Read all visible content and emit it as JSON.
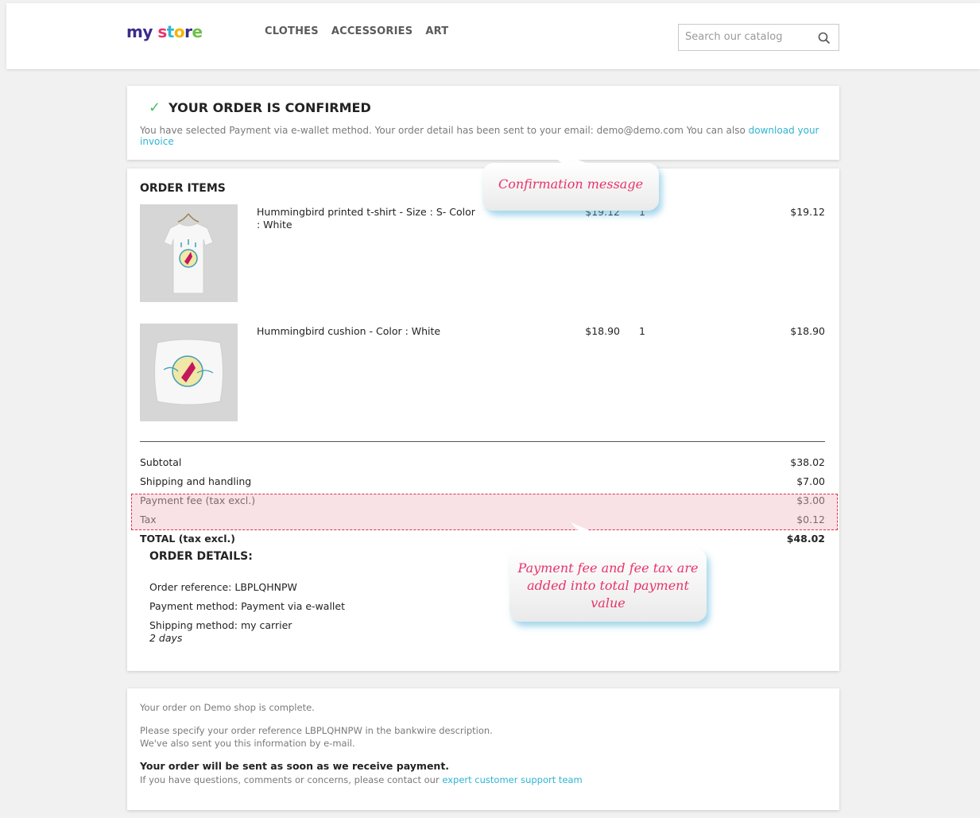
{
  "header": {
    "logo": {
      "part1": "my",
      "part2": "s",
      "part3": "t",
      "part4": "o",
      "part5": "r",
      "part6": "e"
    },
    "nav": [
      "CLOTHES",
      "ACCESSORIES",
      "ART"
    ],
    "search_placeholder": "Search our catalog"
  },
  "confirmation": {
    "title": "YOUR ORDER IS CONFIRMED",
    "text": "You have selected Payment via e-wallet method. Your order detail has been sent to your email: demo@demo.com You can also ",
    "invoice_link": "download your invoice"
  },
  "order_items": {
    "title": "ORDER ITEMS",
    "items": [
      {
        "name": "Hummingbird printed t-shirt - Size : S- Color : White",
        "price": "$19.12",
        "qty": "1",
        "total": "$19.12"
      },
      {
        "name": "Hummingbird cushion - Color : White",
        "price": "$18.90",
        "qty": "1",
        "total": "$18.90"
      }
    ],
    "summary": [
      {
        "label": "Subtotal",
        "value": "$38.02"
      },
      {
        "label": "Shipping and handling",
        "value": "$7.00"
      },
      {
        "label": "Payment fee (tax excl.)",
        "value": "$3.00"
      },
      {
        "label": "Tax",
        "value": "$0.12"
      },
      {
        "label": "TOTAL (tax excl.)",
        "value": "$48.02"
      }
    ]
  },
  "order_details": {
    "title": "ORDER DETAILS:",
    "reference": "Order reference: LBPLQHNPW",
    "payment": "Payment method: Payment via e-wallet",
    "shipping": "Shipping method: my carrier",
    "delay": "2 days"
  },
  "footer_card": {
    "line1": "Your order on Demo shop is complete.",
    "line2": "Please specify your order reference LBPLQHNPW in the bankwire description.",
    "line3": "We've also sent you this information by e-mail.",
    "line4": "Your order will be sent as soon as we receive payment.",
    "line5": "If you have questions, comments or concerns, please contact our ",
    "support_link": "expert customer support team"
  },
  "annotations": {
    "confirmation": "Confirmation message",
    "fee_line1": "Payment fee and fee tax are",
    "fee_line2": "added into total payment",
    "fee_line3": "value"
  },
  "colors": {
    "accent": "#2fb5d2",
    "highlight_border": "#e0304e",
    "annotation_text": "#e8336b"
  }
}
